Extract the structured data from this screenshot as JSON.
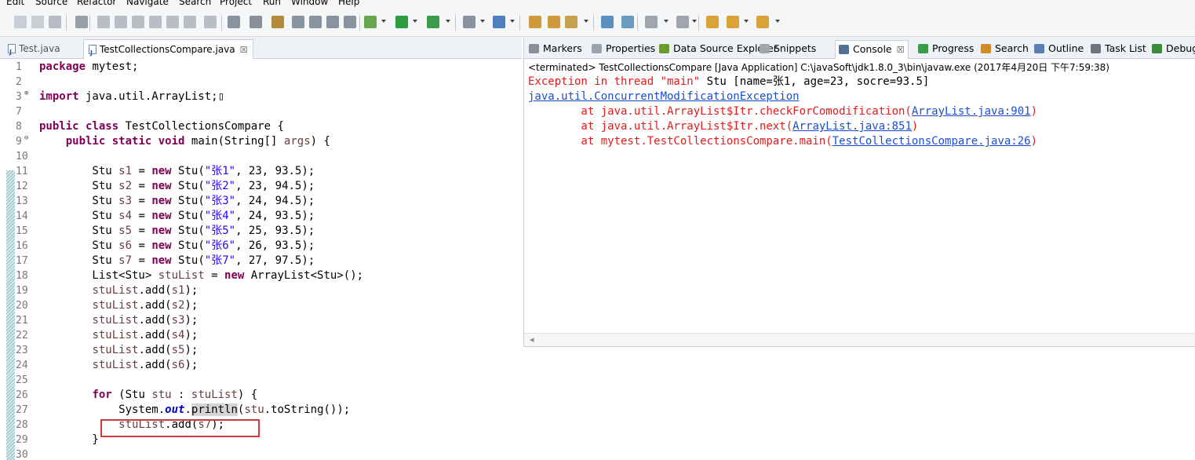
{
  "menu": [
    "Edit",
    "Source",
    "Refactor",
    "Navigate",
    "Search",
    "Project",
    "Run",
    "Window",
    "Help"
  ],
  "editor": {
    "tabs": [
      {
        "label": "Test.java",
        "active": false
      },
      {
        "label": "TestCollectionsCompare.java",
        "active": true,
        "close": "☒"
      }
    ],
    "lines": [
      {
        "n": "1",
        "seg": [
          {
            "t": "package",
            "c": "kw"
          },
          {
            "t": " mytest;"
          }
        ]
      },
      {
        "n": "2",
        "seg": []
      },
      {
        "n": "3",
        "fold": "⊕",
        "seg": [
          {
            "t": "import",
            "c": "kw"
          },
          {
            "t": " java.util.ArrayList;▯"
          }
        ]
      },
      {
        "n": "7",
        "seg": []
      },
      {
        "n": "8",
        "seg": [
          {
            "t": "public",
            "c": "kw"
          },
          {
            "t": " "
          },
          {
            "t": "class",
            "c": "kw"
          },
          {
            "t": " TestCollectionsCompare {"
          }
        ]
      },
      {
        "n": "9",
        "fold": "⊖",
        "seg": [
          {
            "t": "    "
          },
          {
            "t": "public",
            "c": "kw"
          },
          {
            "t": " "
          },
          {
            "t": "static",
            "c": "kw"
          },
          {
            "t": " "
          },
          {
            "t": "void",
            "c": "kw"
          },
          {
            "t": " main(String[] "
          },
          {
            "t": "args",
            "c": "var"
          },
          {
            "t": ") {"
          }
        ]
      },
      {
        "n": "10",
        "seg": []
      },
      {
        "n": "11",
        "seg": [
          {
            "t": "        Stu "
          },
          {
            "t": "s1",
            "c": "var"
          },
          {
            "t": " = "
          },
          {
            "t": "new",
            "c": "kw"
          },
          {
            "t": " Stu("
          },
          {
            "t": "\"张1\"",
            "c": "str"
          },
          {
            "t": ", 23, 93.5);"
          }
        ]
      },
      {
        "n": "12",
        "seg": [
          {
            "t": "        Stu "
          },
          {
            "t": "s2",
            "c": "var"
          },
          {
            "t": " = "
          },
          {
            "t": "new",
            "c": "kw"
          },
          {
            "t": " Stu("
          },
          {
            "t": "\"张2\"",
            "c": "str"
          },
          {
            "t": ", 23, 94.5);"
          }
        ]
      },
      {
        "n": "13",
        "seg": [
          {
            "t": "        Stu "
          },
          {
            "t": "s3",
            "c": "var"
          },
          {
            "t": " = "
          },
          {
            "t": "new",
            "c": "kw"
          },
          {
            "t": " Stu("
          },
          {
            "t": "\"张3\"",
            "c": "str"
          },
          {
            "t": ", 24, 94.5);"
          }
        ]
      },
      {
        "n": "14",
        "seg": [
          {
            "t": "        Stu "
          },
          {
            "t": "s4",
            "c": "var"
          },
          {
            "t": " = "
          },
          {
            "t": "new",
            "c": "kw"
          },
          {
            "t": " Stu("
          },
          {
            "t": "\"张4\"",
            "c": "str"
          },
          {
            "t": ", 24, 93.5);"
          }
        ]
      },
      {
        "n": "15",
        "seg": [
          {
            "t": "        Stu "
          },
          {
            "t": "s5",
            "c": "var"
          },
          {
            "t": " = "
          },
          {
            "t": "new",
            "c": "kw"
          },
          {
            "t": " Stu("
          },
          {
            "t": "\"张5\"",
            "c": "str"
          },
          {
            "t": ", 25, 93.5);"
          }
        ]
      },
      {
        "n": "16",
        "seg": [
          {
            "t": "        Stu "
          },
          {
            "t": "s6",
            "c": "var"
          },
          {
            "t": " = "
          },
          {
            "t": "new",
            "c": "kw"
          },
          {
            "t": " Stu("
          },
          {
            "t": "\"张6\"",
            "c": "str"
          },
          {
            "t": ", 26, 93.5);"
          }
        ]
      },
      {
        "n": "17",
        "seg": [
          {
            "t": "        Stu "
          },
          {
            "t": "s7",
            "c": "var"
          },
          {
            "t": " = "
          },
          {
            "t": "new",
            "c": "kw"
          },
          {
            "t": " Stu("
          },
          {
            "t": "\"张7\"",
            "c": "str"
          },
          {
            "t": ", 27, 97.5);"
          }
        ]
      },
      {
        "n": "18",
        "seg": [
          {
            "t": "        List<Stu> "
          },
          {
            "t": "stuList",
            "c": "var"
          },
          {
            "t": " = "
          },
          {
            "t": "new",
            "c": "kw"
          },
          {
            "t": " ArrayList<Stu>();"
          }
        ]
      },
      {
        "n": "19",
        "seg": [
          {
            "t": "        "
          },
          {
            "t": "stuList",
            "c": "var"
          },
          {
            "t": ".add("
          },
          {
            "t": "s1",
            "c": "var"
          },
          {
            "t": ");"
          }
        ]
      },
      {
        "n": "20",
        "seg": [
          {
            "t": "        "
          },
          {
            "t": "stuList",
            "c": "var"
          },
          {
            "t": ".add("
          },
          {
            "t": "s2",
            "c": "var"
          },
          {
            "t": ");"
          }
        ]
      },
      {
        "n": "21",
        "seg": [
          {
            "t": "        "
          },
          {
            "t": "stuList",
            "c": "var"
          },
          {
            "t": ".add("
          },
          {
            "t": "s3",
            "c": "var"
          },
          {
            "t": ");"
          }
        ]
      },
      {
        "n": "22",
        "seg": [
          {
            "t": "        "
          },
          {
            "t": "stuList",
            "c": "var"
          },
          {
            "t": ".add("
          },
          {
            "t": "s4",
            "c": "var"
          },
          {
            "t": ");"
          }
        ]
      },
      {
        "n": "23",
        "seg": [
          {
            "t": "        "
          },
          {
            "t": "stuList",
            "c": "var"
          },
          {
            "t": ".add("
          },
          {
            "t": "s5",
            "c": "var"
          },
          {
            "t": ");"
          }
        ]
      },
      {
        "n": "24",
        "seg": [
          {
            "t": "        "
          },
          {
            "t": "stuList",
            "c": "var"
          },
          {
            "t": ".add("
          },
          {
            "t": "s6",
            "c": "var"
          },
          {
            "t": ");"
          }
        ]
      },
      {
        "n": "25",
        "seg": []
      },
      {
        "n": "26",
        "seg": [
          {
            "t": "        "
          },
          {
            "t": "for",
            "c": "kw"
          },
          {
            "t": " (Stu "
          },
          {
            "t": "stu",
            "c": "var"
          },
          {
            "t": " : "
          },
          {
            "t": "stuList",
            "c": "var"
          },
          {
            "t": ") {"
          }
        ]
      },
      {
        "n": "27",
        "seg": [
          {
            "t": "            System."
          },
          {
            "t": "out",
            "c": "fld"
          },
          {
            "t": "."
          },
          {
            "t": "println",
            "c": "occ"
          },
          {
            "t": "("
          },
          {
            "t": "stu",
            "c": "var"
          },
          {
            "t": ".toString());"
          }
        ]
      },
      {
        "n": "28",
        "seg": [
          {
            "t": "            "
          },
          {
            "t": "stuList",
            "c": "var"
          },
          {
            "t": ".add("
          },
          {
            "t": "s7",
            "c": "var"
          },
          {
            "t": ");"
          }
        ]
      },
      {
        "n": "29",
        "seg": [
          {
            "t": "        }"
          }
        ]
      },
      {
        "n": "30",
        "seg": []
      }
    ]
  },
  "views": {
    "tabs": [
      {
        "label": "Markers",
        "icon": "markers-icon",
        "color": "#8a8f99"
      },
      {
        "label": "Properties",
        "icon": "properties-icon",
        "color": "#9aa3ad"
      },
      {
        "label": "Data Source Explorer",
        "icon": "data-source-icon",
        "color": "#6a9b2f"
      },
      {
        "label": "Snippets",
        "icon": "snippets-icon",
        "color": "#a0a6ae"
      },
      {
        "label": "Console",
        "icon": "console-icon",
        "color": "#4f6f96",
        "active": true,
        "close": "☒"
      },
      {
        "label": "Progress",
        "icon": "progress-icon",
        "color": "#3a9b4a"
      },
      {
        "label": "Search",
        "icon": "search-icon",
        "color": "#d08a2a"
      },
      {
        "label": "Outline",
        "icon": "outline-icon",
        "color": "#5a7fb0"
      },
      {
        "label": "Task List",
        "icon": "task-list-icon",
        "color": "#6e7480"
      },
      {
        "label": "Debug",
        "icon": "debug-icon",
        "color": "#3a8a3a"
      }
    ],
    "console": {
      "status": "<terminated> TestCollectionsCompare [Java Application] C:\\javaSoft\\jdk1.8.0_3\\bin\\javaw.exe (2017年4月20日 下午7:59:38)",
      "lines": [
        [
          {
            "t": "Exception in thread \"main\" ",
            "c": "err"
          },
          {
            "t": "Stu [name=张1, age=23, socre=93.5]"
          }
        ],
        [
          {
            "t": "java.util.ConcurrentModificationException",
            "c": "lnk"
          }
        ],
        [
          {
            "t": "\tat java.util.ArrayList$Itr.checkForComodification(",
            "c": "err"
          },
          {
            "t": "ArrayList.java:901",
            "c": "lnk"
          },
          {
            "t": ")",
            "c": "err"
          }
        ],
        [
          {
            "t": "\tat java.util.ArrayList$Itr.next(",
            "c": "err"
          },
          {
            "t": "ArrayList.java:851",
            "c": "lnk"
          },
          {
            "t": ")",
            "c": "err"
          }
        ],
        [
          {
            "t": "\tat mytest.TestCollectionsCompare.main(",
            "c": "err"
          },
          {
            "t": "TestCollectionsCompare.java:26",
            "c": "lnk"
          },
          {
            "t": ")",
            "c": "err"
          }
        ]
      ]
    },
    "scroll_chevron": "◂"
  }
}
